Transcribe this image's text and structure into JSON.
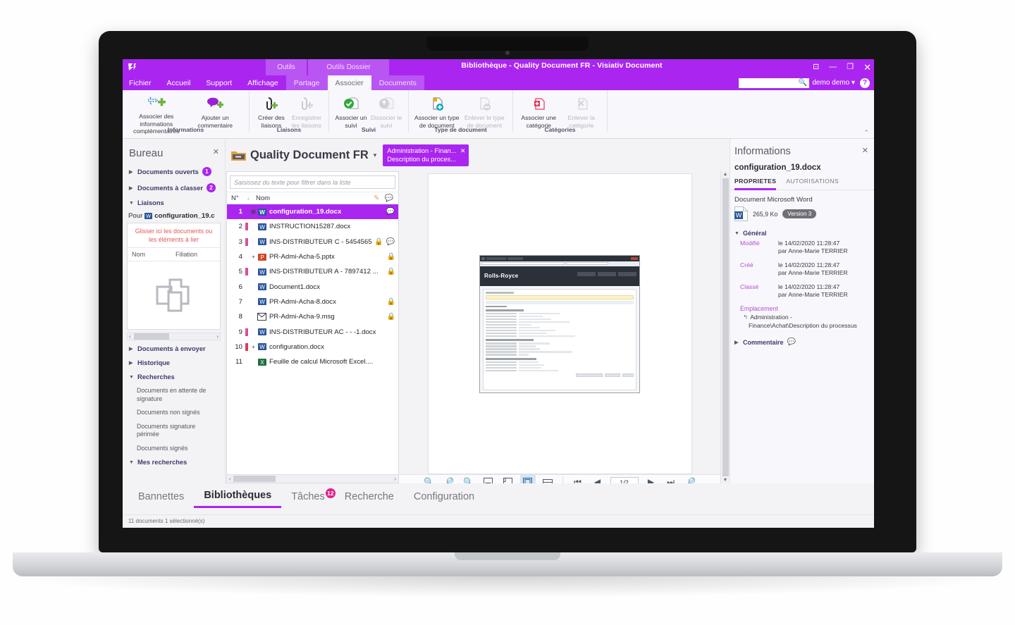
{
  "window": {
    "title": "Bibliothèque - Quality Document FR - Visiativ Document",
    "context_tabs": [
      {
        "label": "Outils"
      },
      {
        "label": "Outils Dossier"
      }
    ],
    "buttons": {
      "restore_small": "⊡",
      "minimize": "—",
      "maximize": "❐",
      "close": "✕"
    },
    "accent_color": "#aa26f0",
    "context_tab_color": "#b955f3"
  },
  "menubar": {
    "items": [
      {
        "label": "Fichier",
        "state": "normal"
      },
      {
        "label": "Accueil",
        "state": "normal"
      },
      {
        "label": "Support",
        "state": "normal"
      },
      {
        "label": "Affichage",
        "state": "normal"
      },
      {
        "label": "Partage",
        "state": "context"
      },
      {
        "label": "Associer",
        "state": "active"
      },
      {
        "label": "Documents",
        "state": "context"
      }
    ],
    "search_placeholder": "",
    "search_value": "",
    "user": "demo demo",
    "user_caret": "▾",
    "help": "?"
  },
  "ribbon": {
    "collapse_arrow": "⌃",
    "groups": [
      {
        "label": "Informations",
        "buttons": [
          {
            "label": "Associer des informations complémentaires",
            "icon": "associate-info-icon",
            "disabled": false
          },
          {
            "label": "Ajouter un commentaire",
            "icon": "add-comment-icon",
            "disabled": false
          }
        ]
      },
      {
        "label": "Liaisons",
        "buttons": [
          {
            "label": "Créer des liaisons",
            "icon": "create-links-icon",
            "disabled": false
          },
          {
            "label": "Enregistrer les liaisons",
            "icon": "save-links-icon",
            "disabled": true
          }
        ]
      },
      {
        "label": "Suivi",
        "buttons": [
          {
            "label": "Associer un suivi",
            "icon": "associate-followup-icon",
            "disabled": false
          },
          {
            "label": "Dissocier le suivi",
            "icon": "dissociate-followup-icon",
            "disabled": true
          }
        ]
      },
      {
        "label": "Type de document",
        "buttons": [
          {
            "label": "Associer un type de document",
            "icon": "associate-doctype-icon",
            "disabled": false
          },
          {
            "label": "Enlever le type de document",
            "icon": "remove-doctype-icon",
            "disabled": true
          }
        ]
      },
      {
        "label": "Catégories",
        "buttons": [
          {
            "label": "Associer une catégorie",
            "icon": "associate-category-icon",
            "disabled": false
          },
          {
            "label": "Enlever la catégorie",
            "icon": "remove-category-icon",
            "disabled": true
          }
        ]
      }
    ]
  },
  "bureau": {
    "title": "Bureau",
    "close": "✕",
    "sections": [
      {
        "label": "Documents ouverts",
        "caret": "▶",
        "badge": "1"
      },
      {
        "label": "Documents à classer",
        "caret": "▶",
        "badge": "2"
      },
      {
        "label": "Liaisons",
        "caret": "▼",
        "badge": ""
      }
    ],
    "pour_prefix": "Pour",
    "pour_file": "configuration_19.c",
    "drop_hint": "Glisser ici les documents ou les éléments à lier",
    "drop_columns": [
      "Nom",
      "Filiation"
    ],
    "scroll_left": "‹",
    "scroll_right": "›",
    "sections2": [
      {
        "label": "Documents à envoyer",
        "caret": "▶"
      },
      {
        "label": "Historique",
        "caret": "▶"
      },
      {
        "label": "Recherches",
        "caret": "▼"
      }
    ],
    "searches": [
      "Documents en attente de signature",
      "Documents non signés",
      "Documents signature périmée",
      "Documents signés"
    ],
    "my_searches": {
      "label": "Mes recherches",
      "caret": "▼"
    }
  },
  "center": {
    "folder_icon": "folder-icon",
    "title": "Quality Document FR",
    "caret": "▾",
    "crumb": {
      "line1": "Administration - Finan...",
      "line2": "Description du proces...",
      "close": "✕"
    },
    "filter_placeholder": "Saisissez du texte pour filtrer dans la liste",
    "filter_value": "",
    "columns": {
      "num": "N°",
      "sort_arrow": "↓",
      "name": "Nom",
      "pen_icon": "edit-pen-icon",
      "comment_icon": "comment-icon"
    },
    "rows": [
      {
        "n": "1",
        "expand": "⊞",
        "icon": "word-icon",
        "name": "configuration_19.docx",
        "mark": false,
        "lock": false,
        "comment": true,
        "selected": true
      },
      {
        "n": "2",
        "expand": "",
        "icon": "word-icon",
        "name": "INSTRUCTION15287.docx",
        "mark": true,
        "lock": false,
        "comment": false,
        "selected": false
      },
      {
        "n": "3",
        "expand": "",
        "icon": "word-icon",
        "name": "INS-DISTRIBUTEUR C - 5454565 ...",
        "mark": true,
        "lock": true,
        "comment": true,
        "selected": false
      },
      {
        "n": "4",
        "expand": "+",
        "icon": "ppt-icon",
        "name": "PR-Admi-Acha-5.pptx",
        "mark": false,
        "lock": true,
        "comment": false,
        "selected": false
      },
      {
        "n": "5",
        "expand": "",
        "icon": "word-icon",
        "name": "INS-DISTRIBUTEUR A - 7897412 ...",
        "mark": true,
        "lock": true,
        "comment": false,
        "selected": false
      },
      {
        "n": "6",
        "expand": "",
        "icon": "word-icon",
        "name": "Document1.docx",
        "mark": false,
        "lock": false,
        "comment": false,
        "selected": false
      },
      {
        "n": "7",
        "expand": "",
        "icon": "word-icon",
        "name": "PR-Admi-Acha-8.docx",
        "mark": false,
        "lock": true,
        "comment": false,
        "selected": false
      },
      {
        "n": "8",
        "expand": "",
        "icon": "mail-icon",
        "name": "PR-Admi-Acha-9.msg",
        "mark": false,
        "lock": true,
        "comment": false,
        "selected": false
      },
      {
        "n": "9",
        "expand": "",
        "icon": "word-icon",
        "name": "INS-DISTRIBUTEUR AC - - -1.docx",
        "mark": true,
        "lock": false,
        "comment": false,
        "selected": false
      },
      {
        "n": "10",
        "expand": "+",
        "icon": "word-icon",
        "name": "configuration.docx",
        "mark": true,
        "lock": false,
        "comment": false,
        "selected": false
      },
      {
        "n": "11",
        "expand": "",
        "icon": "excel-icon",
        "name": "Feuille de calcul Microsoft Excel....",
        "mark": false,
        "lock": false,
        "comment": false,
        "selected": false
      }
    ]
  },
  "preview": {
    "doc_brand": "Rolls-Royce",
    "toolbar": {
      "zoom_in": "zoom-in-icon",
      "zoom_out": "zoom-out-icon",
      "zoom_reset": "zoom-100-icon",
      "fit_text": "fit-text-icon",
      "fit_width": "fit-width-icon",
      "fit_page": "fit-page-icon",
      "two_page": "two-page-icon",
      "first": "⏮",
      "prev": "◀",
      "page": "1/2",
      "next": "▶",
      "last": "⏭",
      "search": "search-icon"
    }
  },
  "info": {
    "title": "Informations",
    "close": "✕",
    "filename": "configuration_19.docx",
    "tabs": [
      {
        "label": "PROPRIETES",
        "active": true
      },
      {
        "label": "AUTORISATIONS",
        "active": false
      }
    ],
    "doc_type": "Document Microsoft Word",
    "file_size": "265,9 Ko",
    "version": "Version 3",
    "general_label": "Général",
    "general_caret": "▼",
    "fields": [
      {
        "key": "Modifié",
        "v1": "le 14/02/2020 11:28:47",
        "v2": "par Anne-Marie TERRIER"
      },
      {
        "key": "Créé",
        "v1": "le 14/02/2020 11:28:47",
        "v2": "par Anne-Marie TERRIER"
      },
      {
        "key": "Classé",
        "v1": "le 14/02/2020 11:28:47",
        "v2": "par Anne-Marie TERRIER"
      }
    ],
    "location_label": "Emplacement",
    "location_arrow": "↰",
    "location_line1": "Administration -",
    "location_line2": "Finance\\Achat\\Description du processus",
    "comment_label": "Commentaire",
    "comment_caret": "▶",
    "comment_icon": "comment-icon"
  },
  "bottom": {
    "tabs": [
      {
        "label": "Bannettes",
        "active": false,
        "count": ""
      },
      {
        "label": "Bibliothèques",
        "active": true,
        "count": ""
      },
      {
        "label": "Tâches",
        "active": false,
        "count": "12"
      },
      {
        "label": "Recherche",
        "active": false,
        "count": ""
      },
      {
        "label": "Configuration",
        "active": false,
        "count": ""
      }
    ],
    "status": "11 documents 1 sélectionné(s)"
  }
}
